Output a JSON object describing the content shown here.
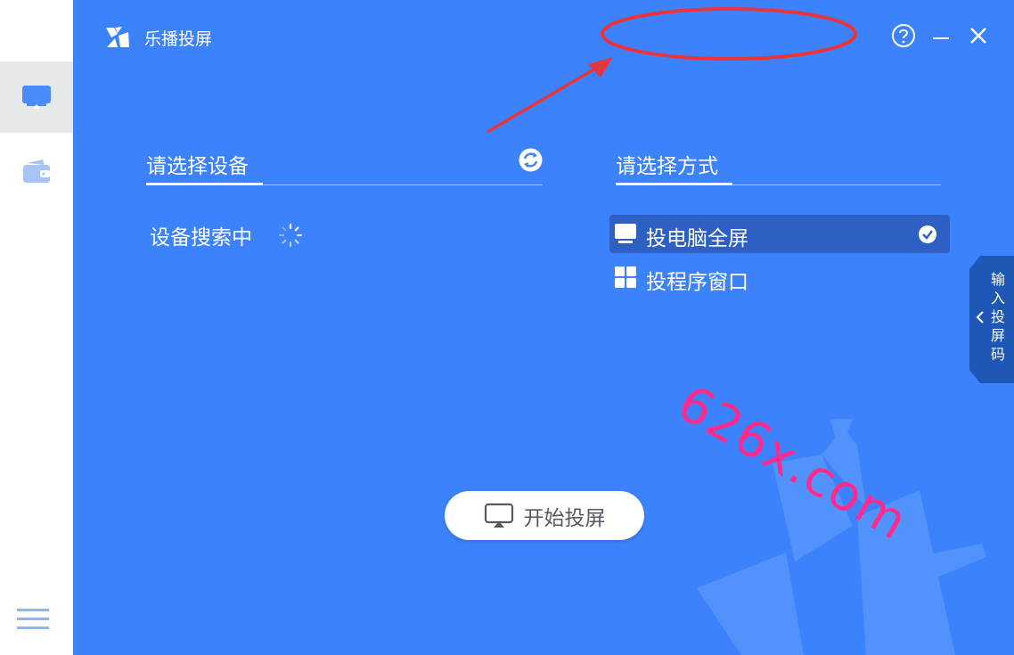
{
  "app": {
    "title": "乐播投屏"
  },
  "sidebar": {
    "items": [
      {
        "icon": "screen-cast-icon",
        "active": true
      },
      {
        "icon": "wallet-icon",
        "active": false
      }
    ],
    "menu_icon": "menu-icon"
  },
  "device_section": {
    "title": "请选择设备",
    "status": "设备搜索中"
  },
  "mode_section": {
    "title": "请选择方式",
    "options": [
      {
        "label": "投电脑全屏",
        "icon": "monitor-icon",
        "selected": true
      },
      {
        "label": "投程序窗口",
        "icon": "windows-grid-icon",
        "selected": false
      }
    ]
  },
  "side_tab": {
    "label": "输入投屏码"
  },
  "start_button": {
    "label": "开始投屏"
  },
  "watermark": "626x.com",
  "colors": {
    "main_bg": "#3d82fd",
    "selected_bg": "#2e5fc2",
    "sidebar_active": "#e6e8ec",
    "annotation_red": "#e8343c",
    "watermark_pink": "#ff2a8c"
  }
}
